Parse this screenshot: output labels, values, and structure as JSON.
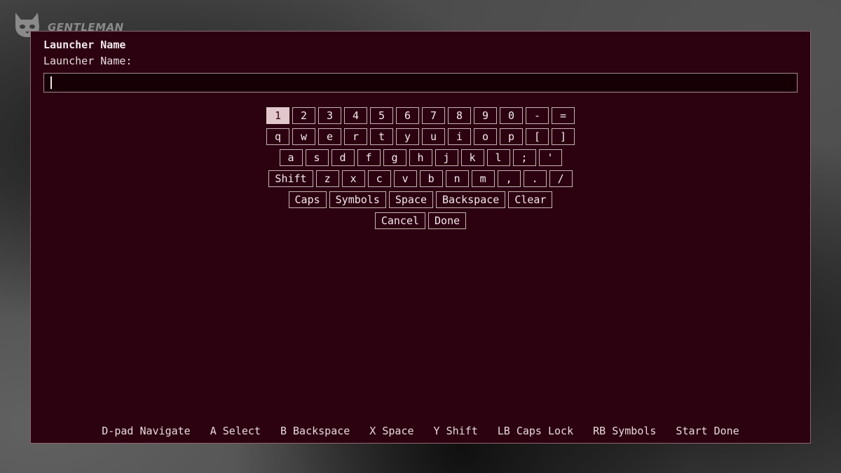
{
  "brand": {
    "text": "GENTLEMAN",
    "icon": "cat-icon"
  },
  "dialog": {
    "title": "Launcher Name",
    "field_label": "Launcher Name:",
    "input_value": ""
  },
  "keyboard": {
    "selected_key": "1",
    "row1": [
      "1",
      "2",
      "3",
      "4",
      "5",
      "6",
      "7",
      "8",
      "9",
      "0",
      "-",
      "="
    ],
    "row2": [
      "q",
      "w",
      "e",
      "r",
      "t",
      "y",
      "u",
      "i",
      "o",
      "p",
      "[",
      "]"
    ],
    "row3": [
      "a",
      "s",
      "d",
      "f",
      "g",
      "h",
      "j",
      "k",
      "l",
      ";",
      "'"
    ],
    "row4": [
      "Shift",
      "z",
      "x",
      "c",
      "v",
      "b",
      "n",
      "m",
      ",",
      ".",
      "/"
    ],
    "row5": [
      "Caps",
      "Symbols",
      "Space",
      "Backspace",
      "Clear"
    ],
    "row6": [
      "Cancel",
      "Done"
    ]
  },
  "hints": [
    "D-pad Navigate",
    "A Select",
    "B Backspace",
    "X Space",
    "Y Shift",
    "LB Caps Lock",
    "RB Symbols",
    "Start Done"
  ],
  "colors": {
    "panel_bg": "#2c0210",
    "selected_key_bg": "#e2c8cd",
    "text": "#f4eaec"
  }
}
